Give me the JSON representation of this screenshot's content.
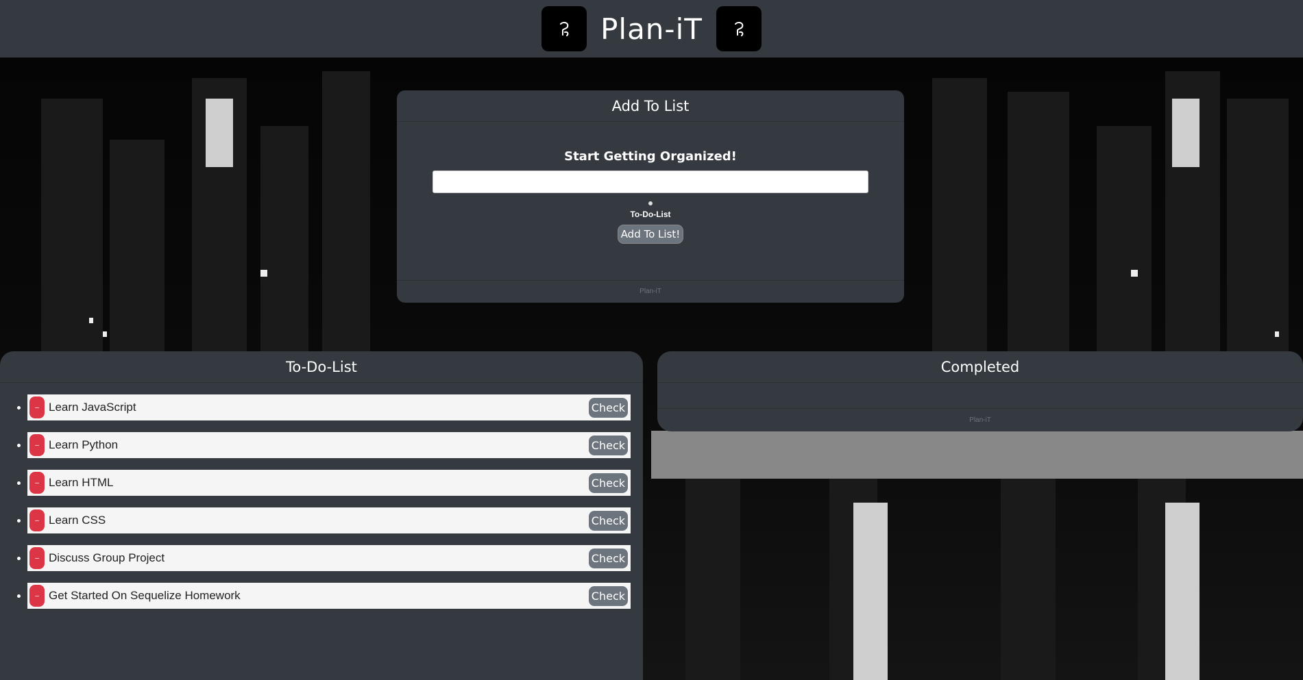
{
  "header": {
    "brand": "Plan-iT",
    "logo_icon": "python-style-logo-icon"
  },
  "add_card": {
    "title": "Add To List",
    "prompt": "Start Getting Organized!",
    "input_value": "",
    "option_label": "To-Do-List",
    "button_label": "Add To List!",
    "footer": "Plan-iT"
  },
  "todo_card": {
    "title": "To-Do-List",
    "items": [
      {
        "text": "Learn JavaScript",
        "delete_label": "–",
        "check_label": "Check"
      },
      {
        "text": "Learn Python",
        "delete_label": "–",
        "check_label": "Check"
      },
      {
        "text": "Learn HTML",
        "delete_label": "–",
        "check_label": "Check"
      },
      {
        "text": "Learn CSS",
        "delete_label": "–",
        "check_label": "Check"
      },
      {
        "text": "Discuss Group Project",
        "delete_label": "–",
        "check_label": "Check"
      },
      {
        "text": "Get Started On Sequelize Homework",
        "delete_label": "–",
        "check_label": "Check"
      }
    ]
  },
  "done_card": {
    "title": "Completed",
    "footer": "Plan-iT"
  },
  "colors": {
    "panel": "#343a40",
    "delete": "#dc3545",
    "check": "#6c757d"
  }
}
